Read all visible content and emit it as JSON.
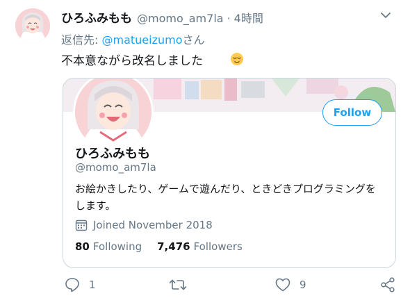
{
  "tweet": {
    "display_name": "ひろふみもも",
    "handle": "@momo_am7la",
    "separator": "·",
    "time": "4時間",
    "reply_prefix": "返信先: ",
    "reply_mention": "@matueizumo",
    "reply_suffix": "さん",
    "text": "不本意ながら改名しました",
    "emoji": "relieved-face-emoji"
  },
  "card": {
    "follow_label": "Follow",
    "name": "ひろふみもも",
    "handle": "@momo_am7la",
    "bio": "お絵かきしたり、ゲームで遊んだり、ときどきプログラミングをします。",
    "joined": "Joined November 2018",
    "following_count": "80",
    "following_label": "Following",
    "followers_count": "7,476",
    "followers_label": "Followers"
  },
  "actions": {
    "reply_count": "1",
    "retweet_count": "",
    "like_count": "9"
  },
  "colors": {
    "accent": "#1da1f2",
    "secondary_text": "#657786",
    "primary_text": "#14171a",
    "border": "#ccd6dd"
  }
}
